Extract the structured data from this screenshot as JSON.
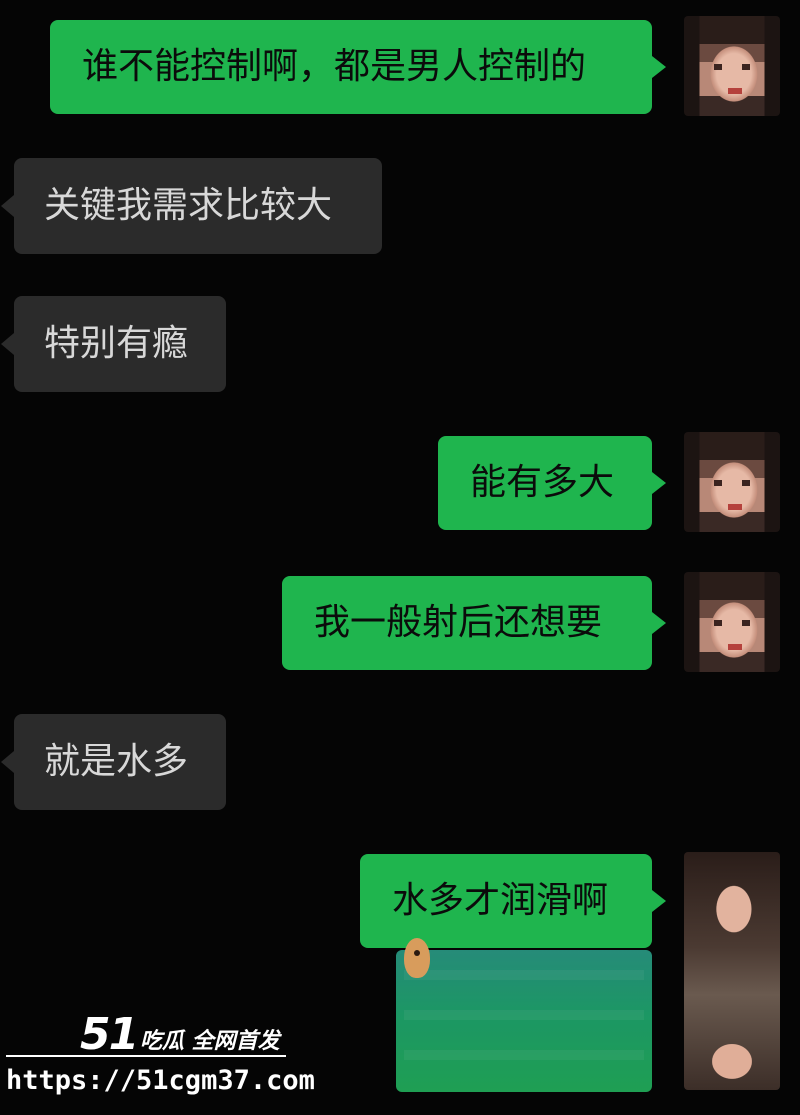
{
  "messages": [
    {
      "side": "right",
      "text": "谁不能控制啊，都是男人控制的"
    },
    {
      "side": "left",
      "text": "关键我需求比较大"
    },
    {
      "side": "left",
      "text": "特别有瘾"
    },
    {
      "side": "right",
      "text": "能有多大"
    },
    {
      "side": "right",
      "text": "我一般射后还想要"
    },
    {
      "side": "left",
      "text": "就是水多"
    },
    {
      "side": "right",
      "text": "水多才润滑啊"
    }
  ],
  "watermark": {
    "logo": "51",
    "tagline": "吃瓜 全网首发",
    "url": "https://51cgm37.com"
  },
  "colors": {
    "background": "#050505",
    "outgoing_bubble": "#1fb54e",
    "incoming_bubble": "#2b2b2b"
  },
  "icons": {
    "avatar": "user-avatar-pixelated",
    "sticker": "sticker-icon"
  }
}
